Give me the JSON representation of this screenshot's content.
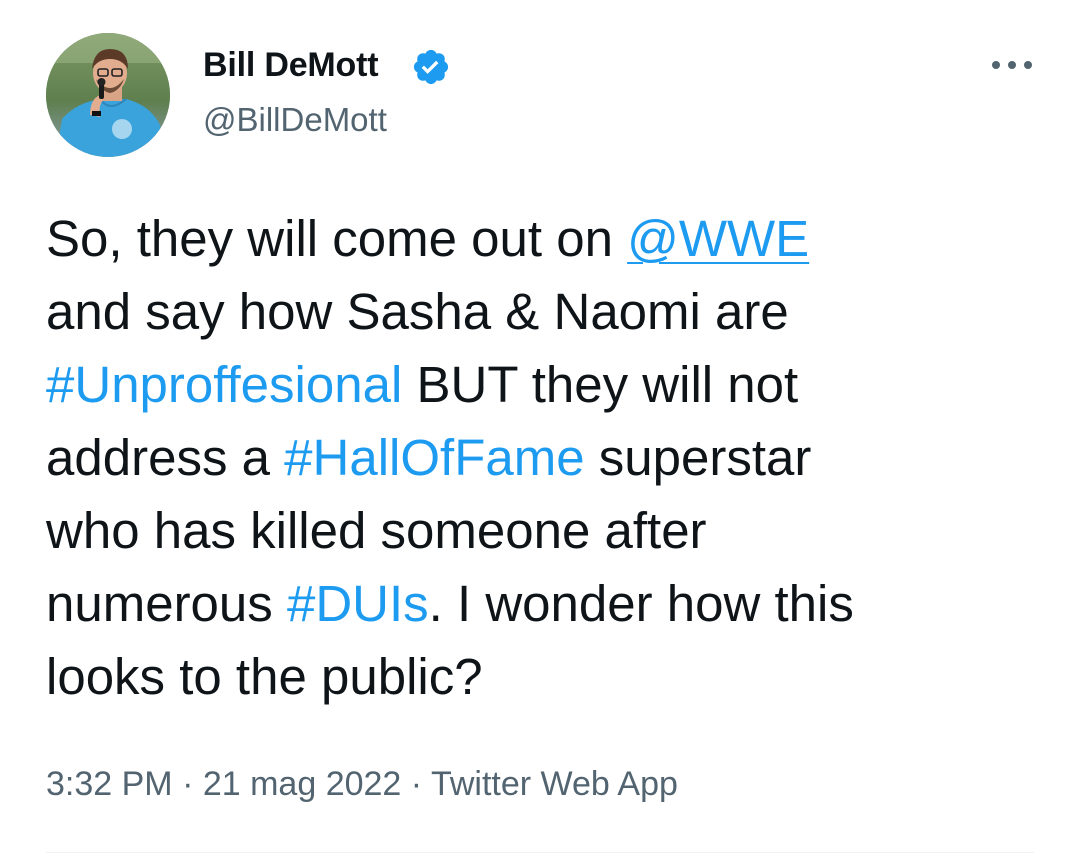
{
  "author": {
    "name": "Bill DeMott",
    "handle": "@BillDeMott",
    "verified": true,
    "avatar_icon": "profile-photo"
  },
  "menu": {
    "more_icon": "more-horizontal-icon"
  },
  "tweet": {
    "segments": [
      {
        "text": "So, they will come out on ",
        "type": "text"
      },
      {
        "text": "@WWE",
        "type": "mention"
      },
      {
        "text": "and say how Sasha & Naomi are",
        "type": "text"
      },
      {
        "text": "#Unproffesional",
        "type": "hashtag"
      },
      {
        "text": " BUT they will not",
        "type": "text"
      },
      {
        "text": "address a ",
        "type": "text"
      },
      {
        "text": "#HallOfFame",
        "type": "hashtag"
      },
      {
        "text": " superstar",
        "type": "text"
      },
      {
        "text": "who has killed someone after",
        "type": "text"
      },
      {
        "text": "numerous ",
        "type": "text"
      },
      {
        "text": "#DUIs",
        "type": "hashtag"
      },
      {
        "text": ". I wonder how this",
        "type": "text"
      },
      {
        "text": "looks to the public?",
        "type": "text"
      }
    ]
  },
  "meta": {
    "time": "3:32 PM",
    "separator": " · ",
    "date": "21 mag 2022",
    "source": "Twitter Web App"
  },
  "colors": {
    "link": "#1d9bf0",
    "text": "#0f1419",
    "secondary": "#536471",
    "verified_badge": "#1d9bf0"
  }
}
